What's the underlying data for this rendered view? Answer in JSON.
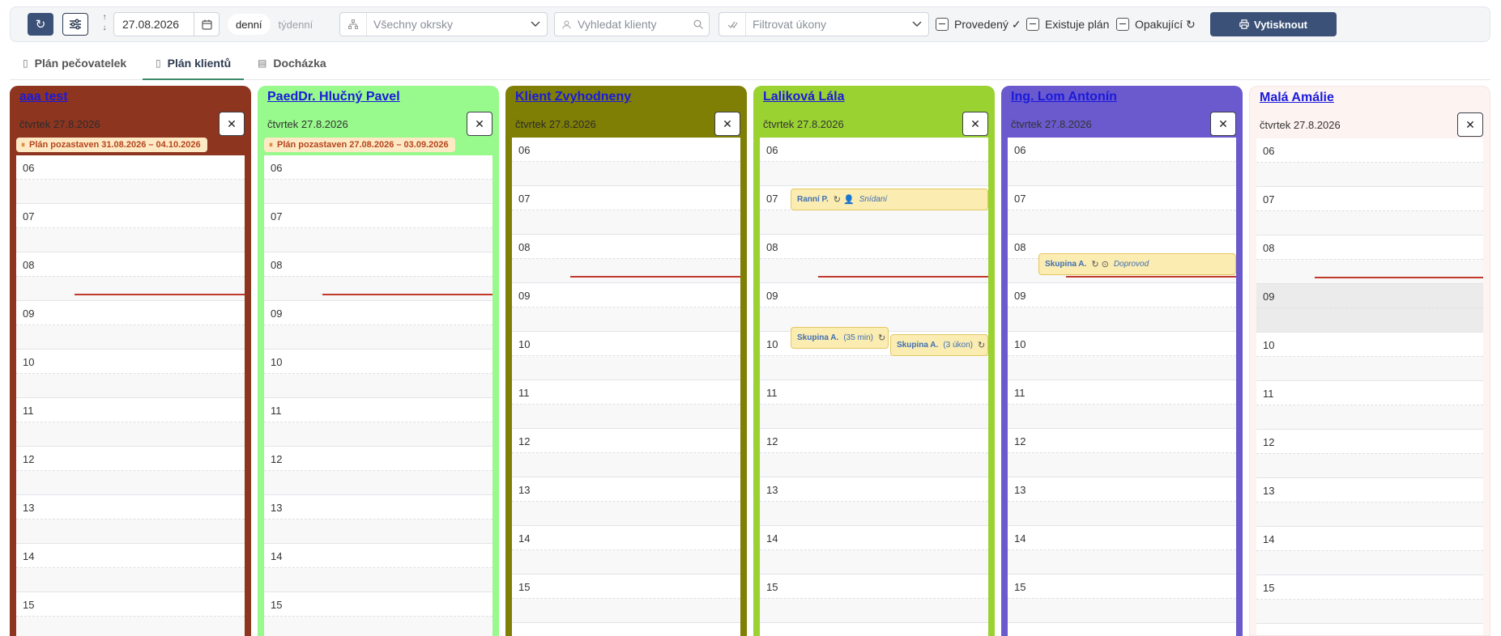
{
  "toolbar": {
    "date": "27.08.2026",
    "views": [
      "denní",
      "týdenní"
    ],
    "district_placeholder": "Všechny okrsky",
    "search_placeholder": "Vyhledat klienty",
    "tasks_placeholder": "Filtrovat úkony",
    "filter_done": "Provedený ✓",
    "filter_plan_exists": "Existuje plán",
    "filter_repeating": "Opakující ↻",
    "print_label": "Vytisknout"
  },
  "tabs": [
    "Plán pečovatelek",
    "Plán klientů",
    "Docházka"
  ],
  "colors": {
    "accent": "#3b5178",
    "event_bg": "#fbecb1",
    "now_line": "#c0392b"
  },
  "columns": [
    {
      "name": "aaa test",
      "date": "čtvrtek 27.8.2026",
      "color": "#8e3520",
      "pause": "Plán pozastaven 31.08.2026 – 04.10.2026",
      "hours": [
        "06",
        "07",
        "08",
        "09",
        "10",
        "11",
        "12",
        "13",
        "14",
        "15"
      ],
      "events": []
    },
    {
      "name": "PaedDr. Hlučný Pavel",
      "date": "čtvrtek 27.8.2026",
      "color": "#98f98c",
      "pause": "Plán pozastaven 27.08.2026 – 03.09.2026",
      "hours": [
        "06",
        "07",
        "08",
        "09",
        "10",
        "11",
        "12",
        "13",
        "14",
        "15"
      ],
      "events": []
    },
    {
      "name": "Klient Zvyhodneny",
      "date": "čtvrtek 27.8.2026",
      "color": "#7f7f05",
      "pause": "",
      "hours": [
        "06",
        "07",
        "08",
        "09",
        "10",
        "11",
        "12",
        "13",
        "14",
        "15"
      ],
      "events": []
    },
    {
      "name": "Laliková Lála",
      "date": "čtvrtek 27.8.2026",
      "color": "#9ad232",
      "pause": "",
      "hours": [
        "06",
        "07",
        "08",
        "09",
        "10",
        "11",
        "12",
        "13",
        "14",
        "15"
      ],
      "events": [
        {
          "name": "Ranní P.",
          "icons": "↻ 👤",
          "extra": "Snídaní"
        },
        {
          "name": "Skupina A.",
          "icons": "↻",
          "extra": "(35 min)"
        },
        {
          "name": "Skupina A.",
          "icons": "↻",
          "extra": "(3 úkon)"
        }
      ]
    },
    {
      "name": "Ing. Lom Antonín",
      "date": "čtvrtek 27.8.2026",
      "color": "#6a5acd",
      "pause": "",
      "hours": [
        "06",
        "07",
        "08",
        "09",
        "10",
        "11",
        "12",
        "13",
        "14",
        "15"
      ],
      "events": [
        {
          "name": "Skupina A.",
          "icons": "↻ ⊙",
          "extra": "Doprovod"
        }
      ]
    },
    {
      "name": "Malá Amálie",
      "date": "čtvrtek 27.8.2026",
      "color": "#fdf3f1",
      "pause": "",
      "hours": [
        "06",
        "07",
        "08",
        "09",
        "10",
        "11",
        "12",
        "13",
        "14",
        "15"
      ],
      "events": []
    }
  ]
}
